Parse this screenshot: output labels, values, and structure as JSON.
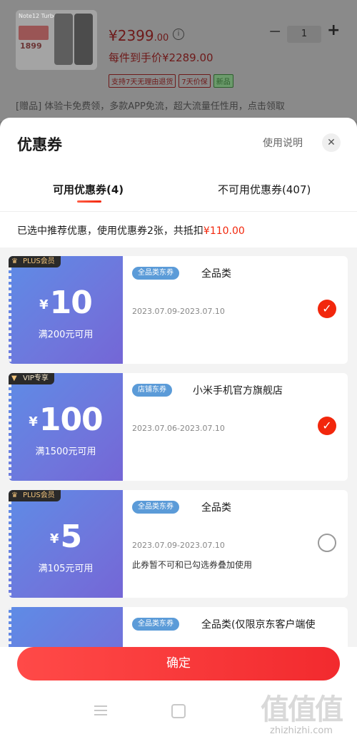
{
  "product": {
    "image_brand": "Note12 Turbo",
    "image_tag_text": "1899",
    "price_currency": "¥",
    "price_main": "2399",
    "price_decimal": ".00",
    "final_price_text": "每件到手价¥2289.00",
    "quantity": "1",
    "service_tags": [
      "支持7天无理由退货",
      "7天价保",
      "新品"
    ],
    "gift_text": "[赠品]  体验卡免费领，多款APP免流，超大流量任性用，点击领取"
  },
  "sheet": {
    "title": "优惠券",
    "help_label": "使用说明",
    "close_glyph": "✕",
    "tabs": [
      {
        "label": "可用优惠券(4)"
      },
      {
        "label": "不可用优惠券(407)"
      }
    ],
    "summary_prefix": "已选中推荐优惠，使用优惠券2张，共抵扣",
    "summary_amount": "¥110.00"
  },
  "coupons": [
    {
      "badge": "PLUS会员",
      "badge_icon": "crown-icon",
      "yen": "¥",
      "amount": "10",
      "condition": "满200元可用",
      "type_tag": "全品类东券",
      "name": "全品类",
      "validity": "2023.07.09-2023.07.10",
      "note": "",
      "selected": true
    },
    {
      "badge": "VIP专享",
      "badge_icon": "vip-v-icon",
      "yen": "¥",
      "amount": "100",
      "condition": "满1500元可用",
      "type_tag": "店铺东券",
      "name": "小米手机官方旗舰店",
      "validity": "2023.07.06-2023.07.10",
      "note": "",
      "selected": true
    },
    {
      "badge": "PLUS会员",
      "badge_icon": "crown-icon",
      "yen": "¥",
      "amount": "5",
      "condition": "满105元可用",
      "type_tag": "全品类东券",
      "name": "全品类",
      "validity": "2023.07.09-2023.07.10",
      "note": "此券暂不可和已勾选券叠加使用",
      "selected": false
    },
    {
      "badge": "",
      "type_tag": "全品类东券",
      "name": "全品类(仅限京东客户端使",
      "validity": "",
      "note": "",
      "selected": false
    }
  ],
  "confirm_label": "确定",
  "watermark": {
    "logo": "值值值",
    "url": "zhizhizhi.com"
  },
  "colors": {
    "accent": "#f2270c",
    "coupon_blue": "#6f76dc",
    "tag_blue": "#5b9bd8"
  }
}
